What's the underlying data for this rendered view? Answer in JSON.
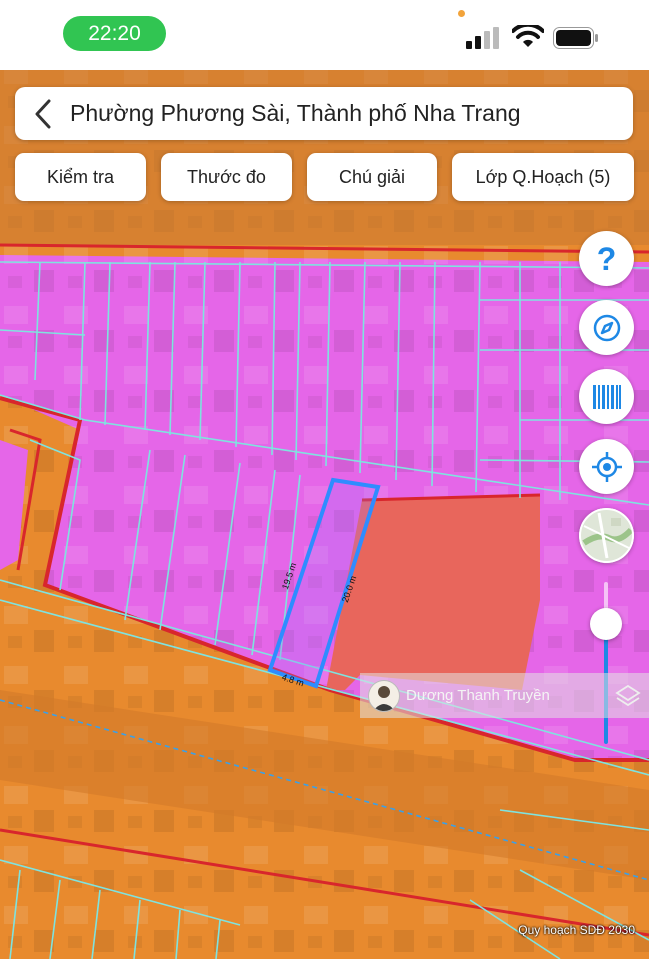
{
  "status_bar": {
    "time": "22:20"
  },
  "header": {
    "title": "Phường Phương Sài, Thành phố Nha Trang"
  },
  "toolbar": {
    "buttons": [
      {
        "label": "Kiểm tra"
      },
      {
        "label": "Thước đo"
      },
      {
        "label": "Chú giải"
      },
      {
        "label": "Lớp Q.Hoạch (5)"
      }
    ]
  },
  "side_controls": {
    "help_label": "?",
    "icons": [
      "help-icon",
      "compass-icon",
      "barcode-icon",
      "locate-icon",
      "basemap-thumbnail"
    ],
    "opacity_level": 0.6
  },
  "parcel": {
    "side_lengths": {
      "front": "4.8 m",
      "left": "19.5 m",
      "right": "20.0 m"
    }
  },
  "watermark": {
    "name": "Dương Thanh Truyền"
  },
  "map_caption": "Quy hoạch SDĐ 2030",
  "colors": {
    "status_pill": "#31c552",
    "accent_blue": "#1e88e5",
    "land_orange": "#e88a2e",
    "land_magenta": "#e566e8",
    "land_red": "#e8665c",
    "boundary_red": "#d8262c",
    "parcel_cyan": "#7fe3df",
    "selected_parcel": "#2f8cff"
  }
}
